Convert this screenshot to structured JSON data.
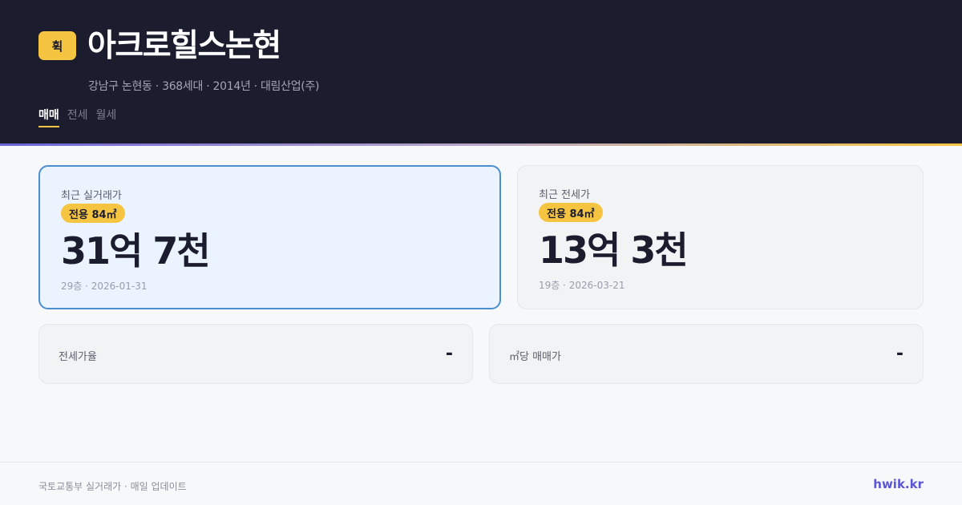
{
  "header": {
    "logo_text": "휙",
    "title": "아크로힐스논현",
    "subtitle": "강남구 논현동 · 368세대 · 2014년 · 대림산업(주)",
    "tabs": [
      {
        "label": "매매",
        "active": true
      },
      {
        "label": "전세",
        "active": false
      },
      {
        "label": "월세",
        "active": false
      }
    ]
  },
  "cards": {
    "sale": {
      "label": "최근 실거래가",
      "area": "전용 84㎡",
      "price": "31억 7천",
      "meta": "29층 · 2026-01-31"
    },
    "jeonse": {
      "label": "최근 전세가",
      "area": "전용 84㎡",
      "price": "13억 3천",
      "meta": "19층 · 2026-03-21"
    }
  },
  "stats": {
    "jeonse_ratio": {
      "label": "전세가율",
      "value": "-"
    },
    "price_per_m2": {
      "label": "㎡당 매매가",
      "value": "-"
    }
  },
  "footer": {
    "note": "국토교통부 실거래가 · 매일 업데이트",
    "brand": "hwik.kr"
  },
  "colors": {
    "header_bg": "#1b1c2e",
    "accent_yellow": "#f5c542",
    "primary_border": "#4b8fcf",
    "brand": "#5b56d6"
  }
}
